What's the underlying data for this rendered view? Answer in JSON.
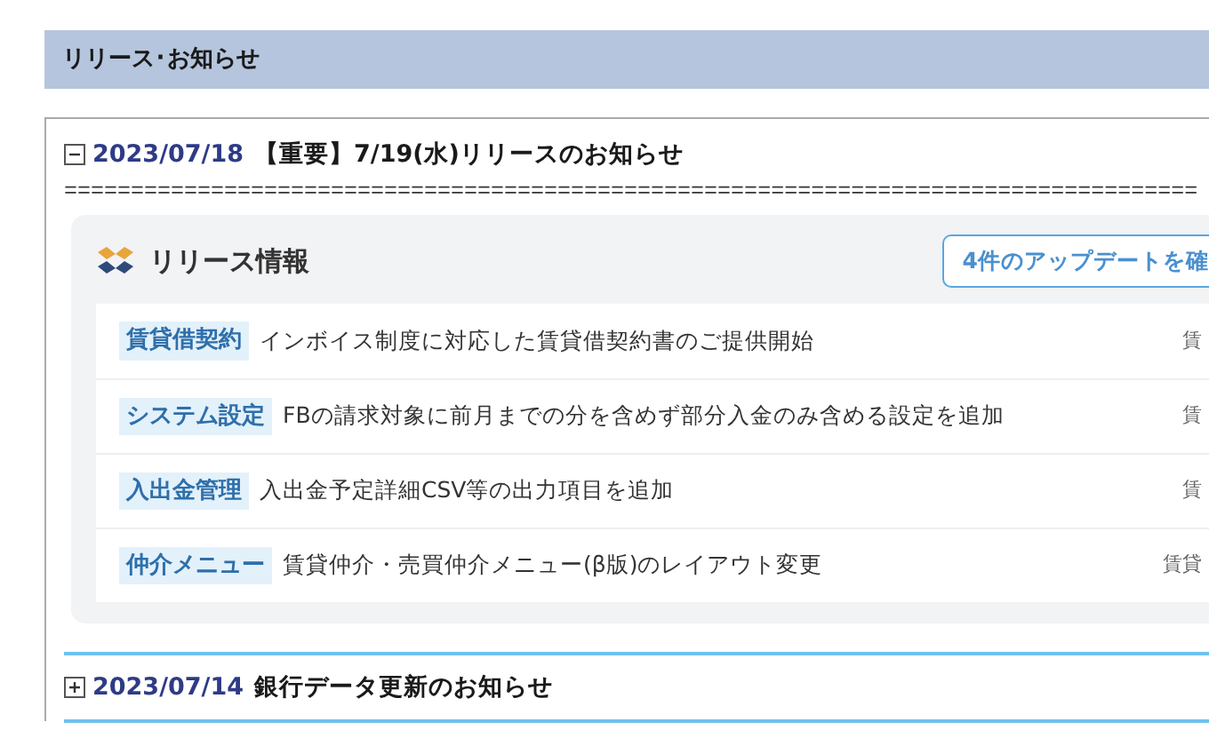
{
  "section_title": "リリース･お知らせ",
  "notices": [
    {
      "expanded": true,
      "date": "2023/07/18",
      "title": "【重要】7/19(水)リリースのお知らせ",
      "separator": "=====================================================================================",
      "release_card": {
        "title": "リリース情報",
        "button": "4件のアップデートを確",
        "items": [
          {
            "category": "賃貸借契約",
            "text": "インボイス制度に対応した賃貸借契約書のご提供開始",
            "column_3": "賃"
          },
          {
            "category": "システム設定",
            "text": "FBの請求対象に前月までの分を含めず部分入金のみ含める設定を追加",
            "column_3": "賃"
          },
          {
            "category": "入出金管理",
            "text": "入出金予定詳細CSV等の出力項目を追加",
            "column_3": "賃"
          },
          {
            "category": "仲介メニュー",
            "text": "賃貸仲介・売買仲介メニュー(β版)のレイアウト変更",
            "column_3": "賃貸"
          }
        ]
      }
    },
    {
      "expanded": false,
      "date": "2023/07/14",
      "title": "銀行データ更新のお知らせ"
    }
  ]
}
